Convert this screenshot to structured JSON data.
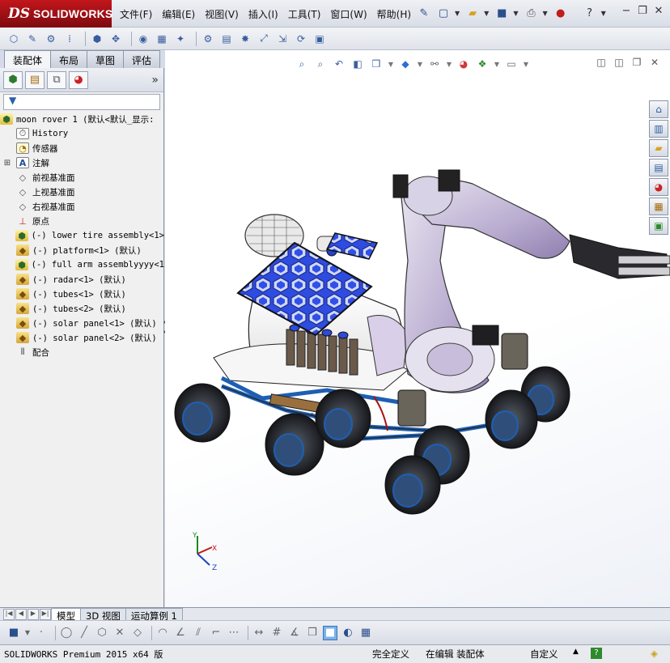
{
  "app": {
    "logo_prefix": "DS",
    "logo_name": "SOLIDWORKS"
  },
  "menu": [
    "文件(F)",
    "编辑(E)",
    "视图(V)",
    "插入(I)",
    "工具(T)",
    "窗口(W)",
    "帮助(H)"
  ],
  "tabs": [
    {
      "label": "装配体",
      "active": true
    },
    {
      "label": "布局",
      "active": false
    },
    {
      "label": "草图",
      "active": false
    },
    {
      "label": "评估",
      "active": false
    }
  ],
  "tree": {
    "root": "moon rover 1  (默认<默认_显示:",
    "items": [
      {
        "label": "History",
        "icon": "history-icon"
      },
      {
        "label": "传感器",
        "icon": "sensor-icon"
      },
      {
        "label": "注解",
        "icon": "annotation-icon",
        "expandable": true
      },
      {
        "label": "前视基准面",
        "icon": "plane-icon"
      },
      {
        "label": "上视基准面",
        "icon": "plane-icon"
      },
      {
        "label": "右视基准面",
        "icon": "plane-icon"
      },
      {
        "label": "原点",
        "icon": "origin-icon"
      },
      {
        "label": "(-) lower tire assembly<1>",
        "icon": "subassembly-icon"
      },
      {
        "label": "(-) platform<1> (默认)",
        "icon": "part-icon"
      },
      {
        "label": "(-) full arm assemblyyyy<1",
        "icon": "subassembly-icon"
      },
      {
        "label": "(-) radar<1> (默认)",
        "icon": "part-icon"
      },
      {
        "label": "(-) tubes<1> (默认)",
        "icon": "part-icon"
      },
      {
        "label": "(-) tubes<2> (默认)",
        "icon": "part-icon"
      },
      {
        "label": "(-) solar panel<1> (默认)",
        "icon": "part-icon"
      },
      {
        "label": "(-) solar panel<2> (默认)",
        "icon": "part-icon"
      },
      {
        "label": "配合",
        "icon": "mates-icon"
      }
    ]
  },
  "bottom_tabs": [
    {
      "label": "模型",
      "active": true
    },
    {
      "label": "3D 视图",
      "active": false
    },
    {
      "label": "运动算例 1",
      "active": false
    }
  ],
  "triad": {
    "x": "X",
    "y": "Y",
    "z": "Z"
  },
  "status": {
    "product": "SOLIDWORKS Premium 2015 x64 版",
    "definition": "完全定义",
    "editing": "在编辑 装配体",
    "units": "自定义"
  },
  "colors": {
    "logo_red": "#b0141a",
    "arm_purple": "#9a86b8",
    "solar_blue": "#2440d8",
    "edge_blue": "#1e5fb3"
  }
}
